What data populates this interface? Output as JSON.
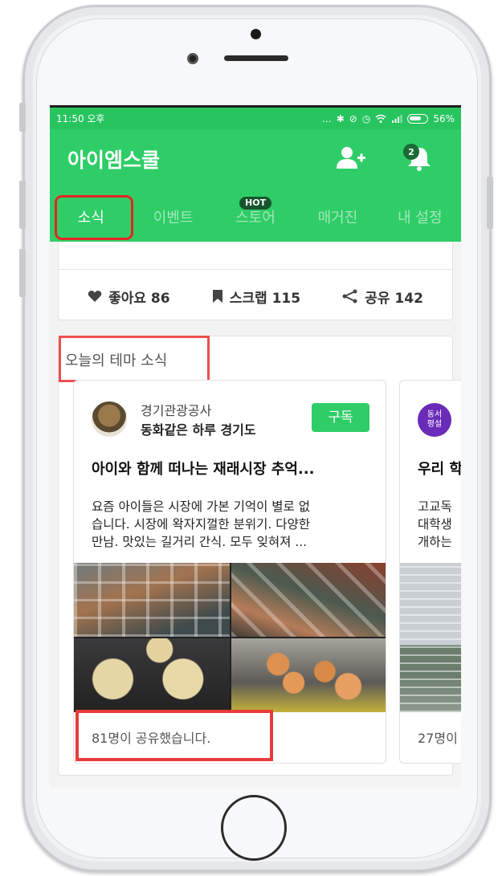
{
  "status_bar": {
    "time": "11:50 오후",
    "battery": "56%",
    "icons": [
      "more-dots-icon",
      "bluetooth-icon",
      "mute-icon",
      "alarm-icon",
      "wifi-icon",
      "signal-icon",
      "battery-icon"
    ]
  },
  "app_bar": {
    "title": "아이엠스쿨",
    "notification_count": "2"
  },
  "tabs": [
    {
      "label": "소식",
      "active": true
    },
    {
      "label": "이벤트",
      "active": false
    },
    {
      "label": "스토어",
      "active": false,
      "badge": "HOT"
    },
    {
      "label": "매거진",
      "active": false
    },
    {
      "label": "내 설정",
      "active": false
    }
  ],
  "post_actions": {
    "like_label": "좋아요 86",
    "scrap_label": "스크랩 115",
    "share_label": "공유 142"
  },
  "theme_section": {
    "title": "오늘의 테마 소식",
    "cards": [
      {
        "publisher": "경기관광공사",
        "publisher_sub": "동화같은 하루 경기도",
        "subscribe_label": "구독",
        "title": "아이와 함께 떠나는 재래시장 추억...",
        "body_lines": [
          "요즘 아이들은 시장에 가본 기억이 별로 없",
          "습니다. 시장에 왁자지껄한 분위기. 다양한",
          "만남. 맛있는 길거리 간식. 모두 잊혀져 ..."
        ],
        "share_count": "81명이 공유했습니다."
      },
      {
        "avatar_text_1": "동서",
        "avatar_text_2": "평설",
        "title": "우리 학",
        "body_lines": [
          "고교독",
          "대학생",
          "개하는"
        ],
        "share_count": "27명이"
      }
    ]
  },
  "colors": {
    "primary": "#2fcd67",
    "highlight": "#e32626"
  }
}
